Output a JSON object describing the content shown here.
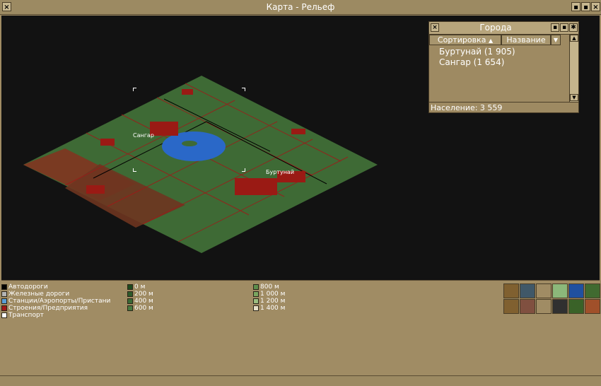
{
  "window": {
    "title": "Карта - Рельеф",
    "close_glyph": "×",
    "buttons": [
      "▪",
      "▪",
      "×"
    ]
  },
  "map": {
    "cities": [
      {
        "name": "Сангар"
      },
      {
        "name": "Буртунай"
      }
    ],
    "colors": {
      "background": "#121212",
      "land": "#3e6a35",
      "field": "#7a3a22",
      "water": "#2a68c8",
      "road": "#000000",
      "rail": "#b01818",
      "building": "#9a1a14"
    }
  },
  "cities_panel": {
    "title": "Города",
    "sort_label": "Сортировка",
    "sort_arrow": "▲",
    "name_label": "Название",
    "dropdown_glyph": "▼",
    "close_glyph": "×",
    "sticky_glyph": "▪",
    "shade_glyph": "▪",
    "pin_glyph": "✱",
    "scroll_up": "▲",
    "scroll_down": "▼",
    "rows": [
      "Буртунай (1 905)",
      "Сангар (1 654)"
    ],
    "footer": "Население: 3 559"
  },
  "legend": {
    "items": [
      {
        "label": "Автодороги",
        "color": "#000000"
      },
      {
        "label": "Железные дороги",
        "color": "#b4b4b4"
      },
      {
        "label": "Станции/Аэропорты/Пристани",
        "color": "#5aa0d8"
      },
      {
        "label": "Строения/Предприятия",
        "color": "#a01818"
      },
      {
        "label": "Транспорт",
        "color": "#ffffff"
      }
    ],
    "heights_low": [
      {
        "label": "0 м",
        "color": "#1e4a1e"
      },
      {
        "label": "200 м",
        "color": "#2c5a2a"
      },
      {
        "label": "400 м",
        "color": "#3a6a36"
      },
      {
        "label": "600 м",
        "color": "#487a40"
      }
    ],
    "heights_high": [
      {
        "label": "800 м",
        "color": "#5e8e4c"
      },
      {
        "label": "1 000 м",
        "color": "#7aa660"
      },
      {
        "label": "1 200 м",
        "color": "#9cbe80"
      },
      {
        "label": "1 400 м",
        "color": "#e8e0c8"
      }
    ]
  },
  "toolbar": {
    "tools": [
      {
        "icon": "contours-icon",
        "color": "#806030"
      },
      {
        "icon": "vehicles-icon",
        "color": "#405868"
      },
      {
        "icon": "blank-icon",
        "color": "#a08c64"
      },
      {
        "icon": "terrain-icon",
        "color": "#8cb87a"
      },
      {
        "icon": "trains-icon",
        "color": "#2050a0"
      },
      {
        "icon": "trees-icon",
        "color": "#406a30"
      },
      {
        "icon": "routes-icon",
        "color": "#806030"
      },
      {
        "icon": "industries-icon",
        "color": "#805040"
      },
      {
        "icon": "connections-icon",
        "color": "#a08c64"
      },
      {
        "icon": "signals-icon",
        "color": "#303030"
      },
      {
        "icon": "forest-icon",
        "color": "#3a6228"
      },
      {
        "icon": "owner-icon",
        "color": "#a0502a"
      }
    ]
  }
}
